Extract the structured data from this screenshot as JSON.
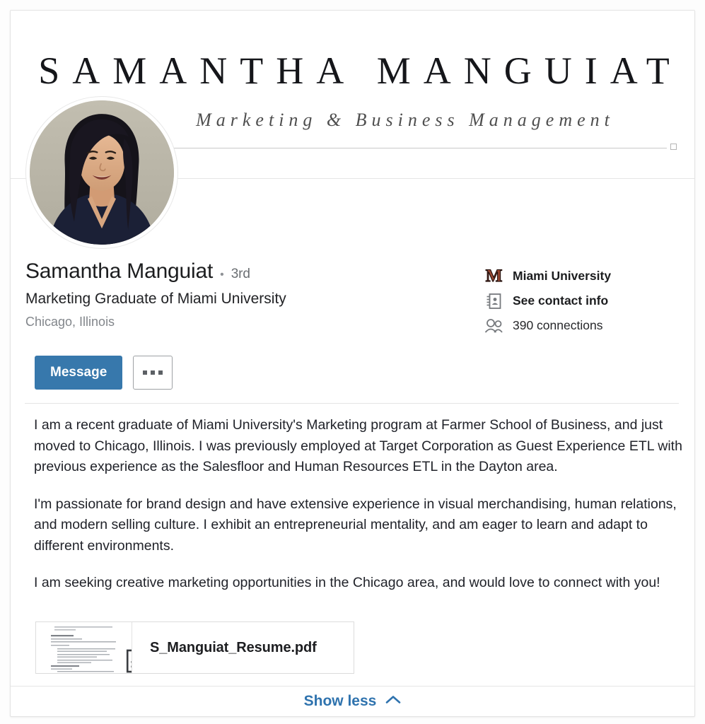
{
  "banner": {
    "title": "SAMANTHA MANGUIAT",
    "subtitle": "Marketing & Business Management",
    "rule_end_marker": "square-handle"
  },
  "avatar": {
    "alt": "Samantha Manguiat profile photo",
    "background_color": "#b8b4a6"
  },
  "identity": {
    "name": "Samantha Manguiat",
    "degree_separator": "•",
    "degree": "3rd",
    "headline": "Marketing Graduate of Miami University",
    "location": "Chicago, Illinois"
  },
  "info": {
    "rows": [
      {
        "icon": "miami-university-logo",
        "label": "Miami University",
        "bold": true
      },
      {
        "icon": "contact-card-icon",
        "label": "See contact info",
        "bold": true
      },
      {
        "icon": "connections-icon",
        "label": "390 connections",
        "bold": false
      }
    ],
    "school": "Miami University",
    "contact_info": "See contact info",
    "connections": "390 connections",
    "logo_letter": "M",
    "logo_color": "#a04a33"
  },
  "actions": {
    "message_label": "Message",
    "more_label": "More actions",
    "message_color": "#3778ac"
  },
  "summary": {
    "paragraphs": [
      "I am a recent graduate of Miami University's Marketing program at Farmer School of Business, and just moved to Chicago, Illinois. I was previously employed at Target Corporation as Guest Experience ETL with previous experience as the Salesfloor and Human Resources ETL in the Dayton area.",
      "I'm passionate for brand design and have extensive experience in visual merchandising, human relations, and modern selling culture. I exhibit an entrepreneurial mentality, and am eager to learn and adapt to different environments.",
      "I am seeking creative marketing opportunities in the Chicago area, and would love to connect with you!"
    ]
  },
  "attachment": {
    "file_name": "S_Manguiat_Resume.pdf",
    "thumbnail_alt": "Resume document preview",
    "file_icon": "document-icon"
  },
  "footer": {
    "show_less_label": "Show less",
    "chevron": "chevron-up-icon",
    "link_color": "#2f73ae"
  }
}
